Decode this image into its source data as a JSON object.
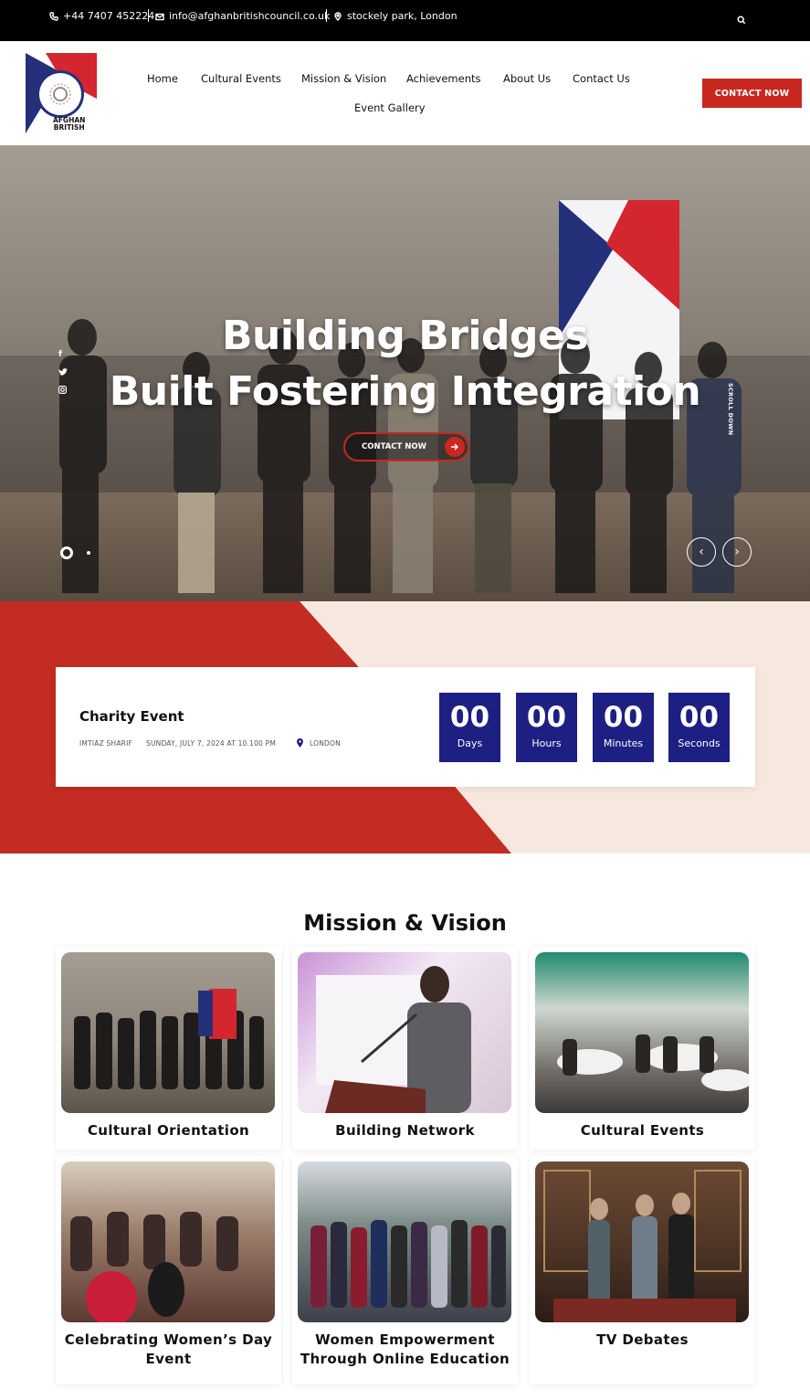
{
  "topbar": {
    "phone": "+44 7407 452224",
    "email": "info@afghanbritishcouncil.co.uk",
    "location": "stockely park, London",
    "phone_icon": "phone-icon",
    "email_icon": "envelope-icon",
    "location_icon": "map-pin-icon",
    "search_icon": "search-icon"
  },
  "logo": {
    "line1": "AFGHAN",
    "line2": "BRITISH"
  },
  "nav": {
    "items": [
      "Home",
      "Cultural Events",
      "Mission & Vision",
      "Achievements",
      "About Us",
      "Contact Us",
      "Event Gallery"
    ]
  },
  "header_button": "CONTACT NOW",
  "hero": {
    "title_line1": "Building Bridges",
    "title_line2": "Built Fostering Integration",
    "button": "CONTACT NOW",
    "scroll_text": "SCROLL DOWN",
    "social": [
      "f",
      "t",
      "ig"
    ],
    "slider_prev": "‹",
    "slider_next": "›"
  },
  "event": {
    "title": "Charity Event",
    "author": "IMTIAZ SHARIF",
    "datetime": "SUNDAY, JULY 7, 2024 AT 10.100 PM",
    "location": "LONDON",
    "countdown": [
      {
        "value": "00",
        "label": "Days"
      },
      {
        "value": "00",
        "label": "Hours"
      },
      {
        "value": "00",
        "label": "Minutes"
      },
      {
        "value": "00",
        "label": "Seconds"
      }
    ]
  },
  "mission": {
    "title": "Mission & Vision",
    "cards": [
      {
        "label": "Cultural Orientation"
      },
      {
        "label": "Building Network"
      },
      {
        "label": "Cultural Events"
      },
      {
        "label": "Celebrating Women’s Day Event"
      },
      {
        "label": "Women Empowerment Through Online Education"
      },
      {
        "label": "TV Debates"
      }
    ]
  },
  "colors": {
    "brand_red": "#c8281f",
    "brand_navy": "#1d1f82",
    "band_bg": "#f7e8df"
  }
}
